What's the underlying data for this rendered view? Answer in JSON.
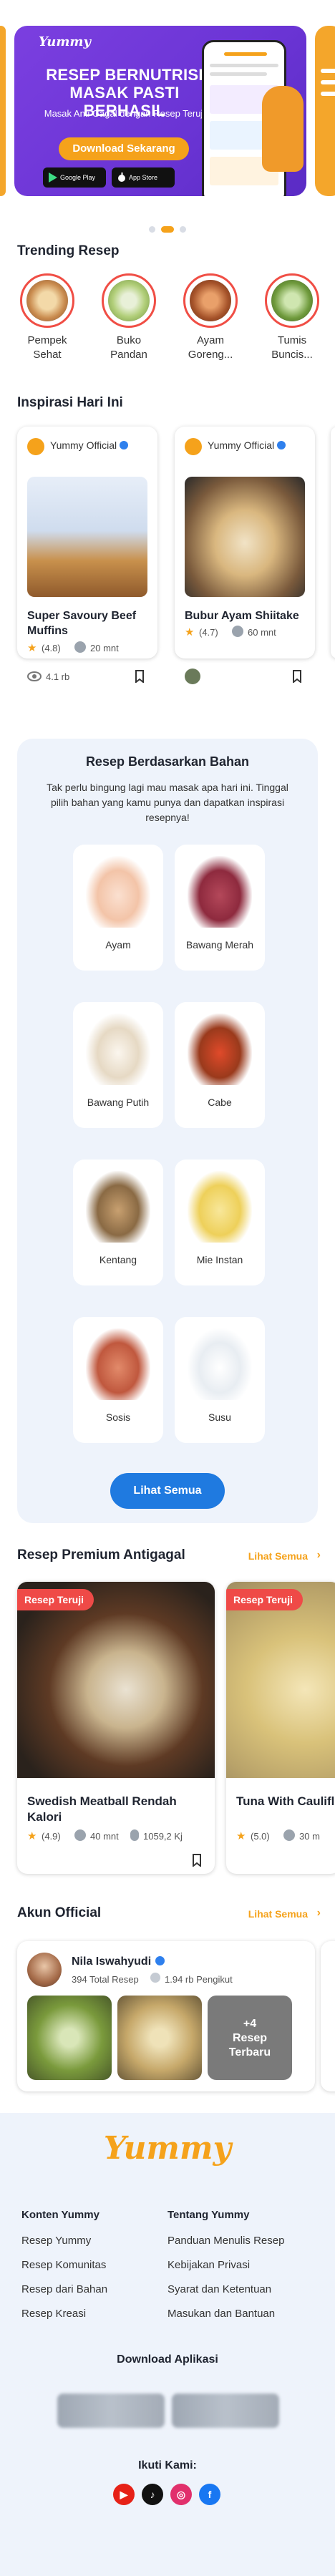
{
  "banner": {
    "logo": "Yummy",
    "headline": "RESEP BERNUTRISI MASAK PASTI BERHASIL",
    "subline": "Masak Anti Gagal dengan Resep Teruji",
    "cta": "Download Sekarang",
    "google_play": "Google Play",
    "app_store": "App Store",
    "accent_color": "#6a34d4"
  },
  "carousel": {
    "pages": 3,
    "active_index": 1
  },
  "trending": {
    "title": "Trending Resep",
    "items": [
      "Pempek Sehat",
      "Buko Pandan",
      "Ayam Goreng...",
      "Tumis Buncis..."
    ]
  },
  "inspirasi": {
    "title": "Inspirasi Hari Ini",
    "cards": [
      {
        "author": "Yummy Official",
        "name": "Super Savoury Beef Muffins",
        "rating": "(4.8)",
        "time": "20 mnt",
        "views": "4.1 rb"
      },
      {
        "author": "Yummy Official",
        "name": "Bubur Ayam Shiitake",
        "rating": "(4.7)",
        "time": "60 mnt"
      }
    ]
  },
  "bahan": {
    "title": "Resep Berdasarkan Bahan",
    "description": "Tak perlu bingung lagi mau masak apa hari ini. Tinggal pilih bahan yang kamu punya dan dapatkan inspirasi resepnya!",
    "items": [
      "Ayam",
      "Bawang Merah",
      "Bawang Putih",
      "Cabe",
      "Kentang",
      "Mie Instan",
      "Sosis",
      "Susu"
    ],
    "button": "Lihat Semua"
  },
  "premium": {
    "title": "Resep Premium Antigagal",
    "see_all": "Lihat Semua",
    "cards": [
      {
        "tag": "Resep Teruji",
        "name": "Swedish Meatball Rendah Kalori",
        "rating": "(4.9)",
        "time": "40 mnt",
        "calories": "1059,2 Kj"
      },
      {
        "tag": "Resep Teruji",
        "name": "Tuna With Cauliflower Cheese",
        "rating": "(5.0)",
        "time": "30 m"
      }
    ]
  },
  "official": {
    "title": "Akun Official",
    "see_all": "Lihat Semua",
    "account": {
      "name": "Nila Iswahyudi",
      "recipes": "394 Total Resep",
      "followers": "1.94 rb Pengikut",
      "more_count": "+4",
      "more_label": "Resep Terbaru"
    }
  },
  "footer": {
    "brand": "Yummy",
    "col1_title": "Konten Yummy",
    "col1_links": [
      "Resep Yummy",
      "Resep Komunitas",
      "Resep dari Bahan",
      "Resep Kreasi"
    ],
    "col2_title": "Tentang Yummy",
    "col2_links": [
      "Panduan Menulis Resep",
      "Kebijakan Privasi",
      "Syarat dan Ketentuan",
      "Masukan dan Bantuan"
    ],
    "download_title": "Download Aplikasi",
    "follow_title": "Ikuti Kami:",
    "social_icons": [
      "youtube-icon",
      "tiktok-icon",
      "instagram-icon",
      "facebook-icon"
    ]
  }
}
